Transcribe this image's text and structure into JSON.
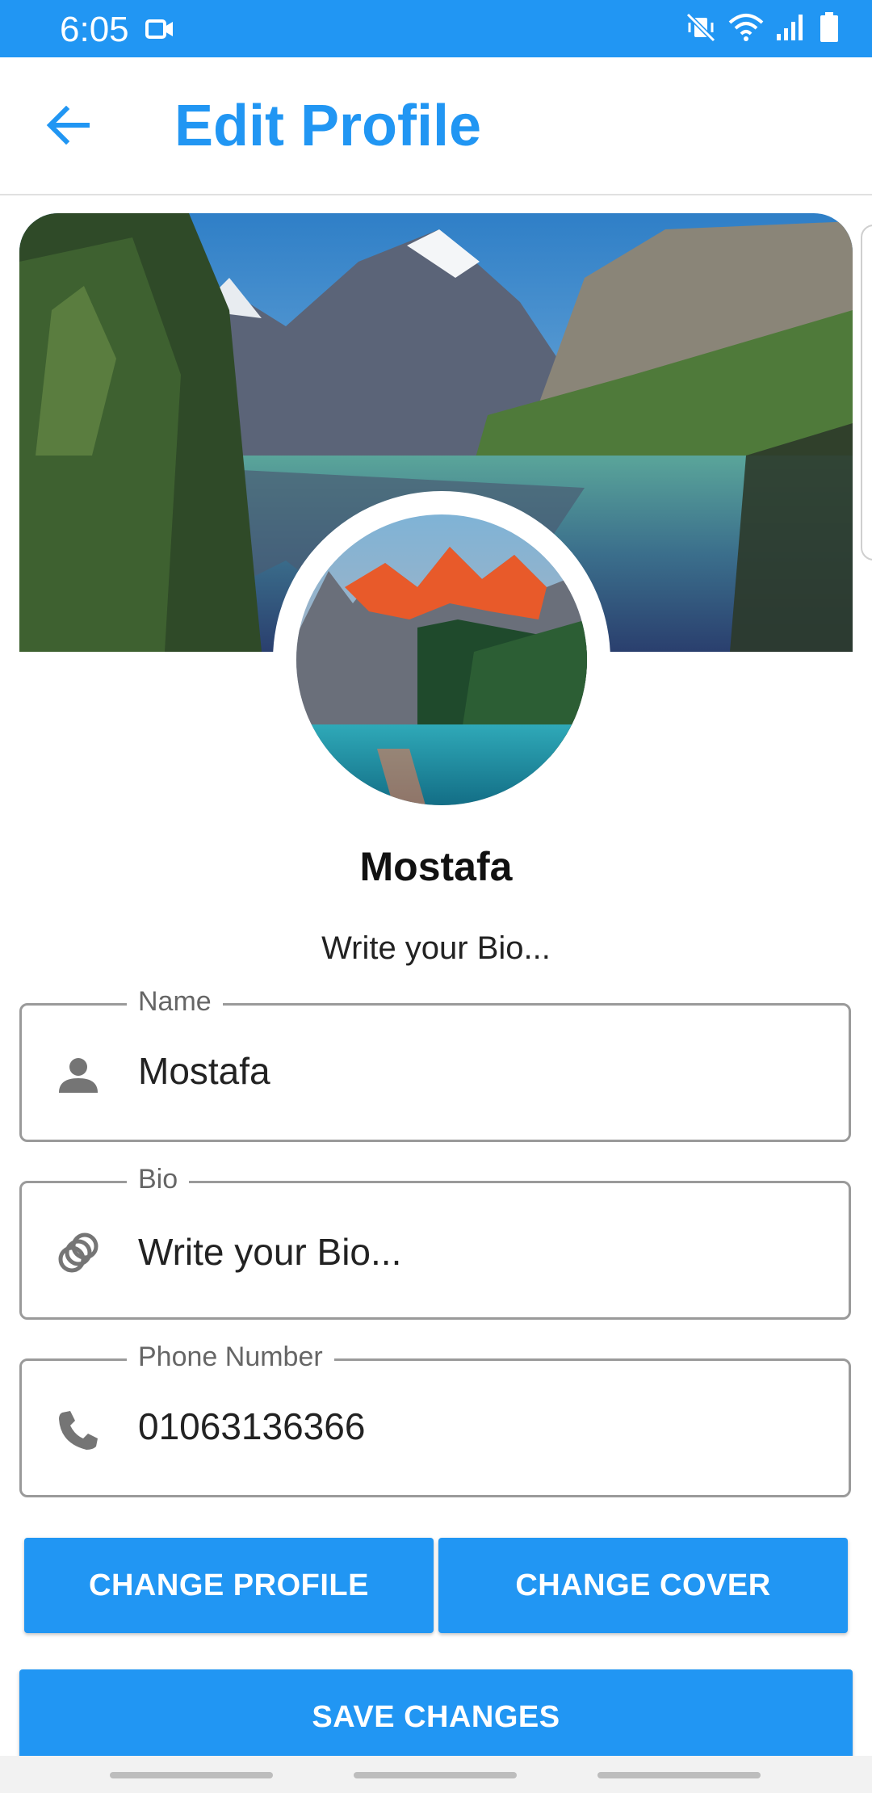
{
  "status_bar": {
    "time": "6:05",
    "icons": [
      "video-camera-icon",
      "vibrate-mute-icon",
      "wifi-icon",
      "signal-icon",
      "battery-icon"
    ],
    "color": "#2196f3"
  },
  "app_bar": {
    "title": "Edit Profile",
    "back_icon": "arrow-back-icon",
    "accent": "#2196f3"
  },
  "profile": {
    "name": "Mostafa",
    "bio_display": "Write your Bio..."
  },
  "form": {
    "name": {
      "label": "Name",
      "value": "Mostafa",
      "icon": "person-icon"
    },
    "bio": {
      "label": "Bio",
      "placeholder": "Write your Bio...",
      "icon": "rings-icon"
    },
    "phone": {
      "label": "Phone Number",
      "value": "01063136366",
      "icon": "phone-icon"
    }
  },
  "buttons": {
    "change_profile": "CHANGE PROFILE",
    "change_cover": "CHANGE COVER",
    "save_changes": "SAVE CHANGES"
  }
}
